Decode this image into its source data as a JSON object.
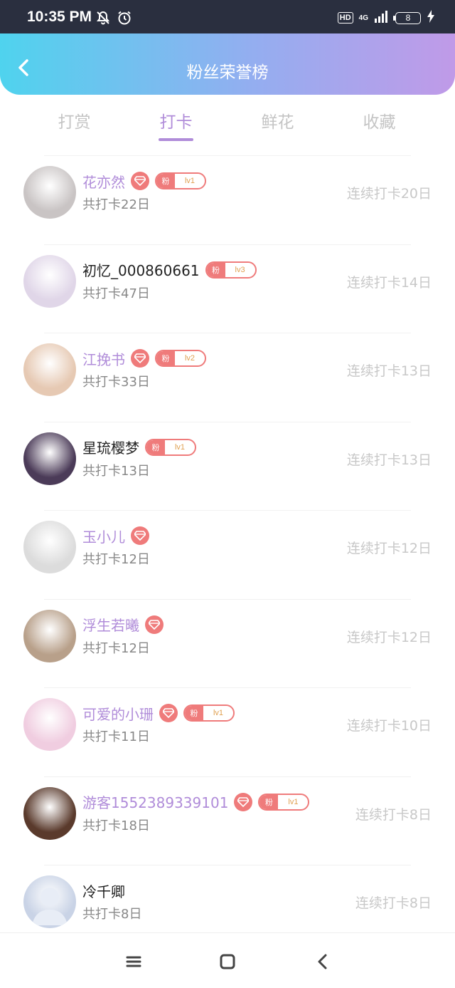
{
  "status": {
    "time": "10:35 PM",
    "hd": "HD",
    "network": "4G",
    "battery": "8"
  },
  "header": {
    "title": "粉丝荣誉榜"
  },
  "tabs": [
    {
      "label": "打赏",
      "active": false
    },
    {
      "label": "打卡",
      "active": true
    },
    {
      "label": "鲜花",
      "active": false
    },
    {
      "label": "收藏",
      "active": false
    }
  ],
  "fans": [
    {
      "name": "花亦然",
      "vip": true,
      "diamond": true,
      "badge": "粉",
      "level": "lv1",
      "total": "共打卡22日",
      "streak": "连续打卡20日",
      "avatar_color": "#c9c4c4"
    },
    {
      "name": "初忆_000860661",
      "vip": false,
      "diamond": false,
      "badge": "粉",
      "level": "lv3",
      "total": "共打卡47日",
      "streak": "连续打卡14日",
      "avatar_color": "#e0d6e8"
    },
    {
      "name": "江挽书",
      "vip": true,
      "diamond": true,
      "badge": "粉",
      "level": "lv2",
      "total": "共打卡33日",
      "streak": "连续打卡13日",
      "avatar_color": "#e6c9b3"
    },
    {
      "name": "星琉樱梦",
      "vip": false,
      "diamond": false,
      "badge": "粉",
      "level": "lv1",
      "total": "共打卡13日",
      "streak": "连续打卡13日",
      "avatar_color": "#4b3b58"
    },
    {
      "name": "玉小儿",
      "vip": true,
      "diamond": true,
      "badge": "",
      "level": "",
      "total": "共打卡12日",
      "streak": "连续打卡12日",
      "avatar_color": "#dcdcdc"
    },
    {
      "name": "浮生若曦",
      "vip": true,
      "diamond": true,
      "badge": "",
      "level": "",
      "total": "共打卡12日",
      "streak": "连续打卡12日",
      "avatar_color": "#b8a08a"
    },
    {
      "name": "可爱的小珊",
      "vip": true,
      "diamond": true,
      "badge": "粉",
      "level": "lv1",
      "total": "共打卡11日",
      "streak": "连续打卡10日",
      "avatar_color": "#f0cde0"
    },
    {
      "name": "游客1552389339101",
      "vip": true,
      "diamond": true,
      "badge": "粉",
      "level": "lv1",
      "total": "共打卡18日",
      "streak": "连续打卡8日",
      "avatar_color": "#5a3a2c"
    },
    {
      "name": "冷千卿",
      "vip": false,
      "diamond": false,
      "badge": "",
      "level": "",
      "total": "共打卡8日",
      "streak": "连续打卡8日",
      "avatar_color": "#c9d3e6"
    }
  ]
}
